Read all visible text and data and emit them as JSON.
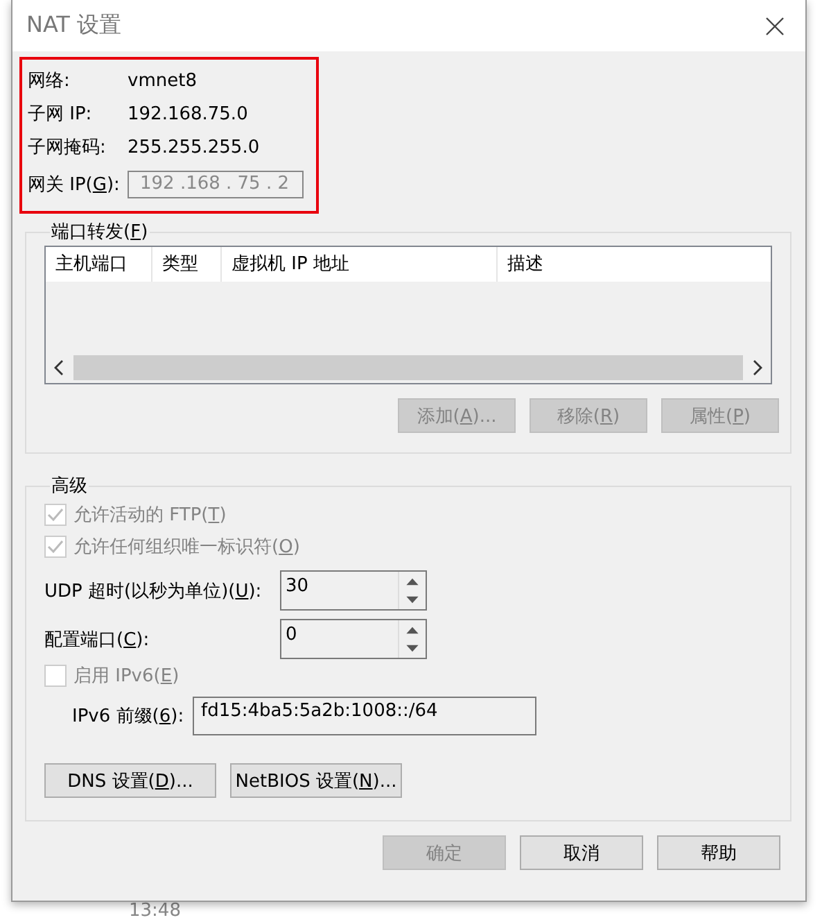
{
  "window": {
    "title": "NAT 设置"
  },
  "background": {
    "time": "13:48"
  },
  "network_info": {
    "highlighted": true,
    "rows": [
      {
        "kind": "text",
        "label": {
          "text": "网络:"
        },
        "value": "vmnet8"
      },
      {
        "kind": "text",
        "label": {
          "text": "子网 IP:"
        },
        "value": "192.168.75.0"
      },
      {
        "kind": "text",
        "label": {
          "text": "子网掩码:"
        },
        "value": "255.255.255.0"
      },
      {
        "kind": "field",
        "label": {
          "text": "网关 IP(",
          "key": "G",
          "after": "):"
        },
        "value": "192 .168 . 75 . 2",
        "disabled": true
      }
    ]
  },
  "port_forwarding": {
    "legend": {
      "text": "端口转发(",
      "key": "F",
      "after": ")"
    },
    "table": {
      "columns": [
        "主机端口",
        "类型",
        "虚拟机 IP 地址",
        "描述"
      ]
    },
    "buttons": [
      {
        "label": {
          "text": "添加(",
          "key": "A",
          "after": ")..."
        },
        "disabled": true
      },
      {
        "label": {
          "text": "移除(",
          "key": "R",
          "after": ")"
        },
        "disabled": true
      },
      {
        "label": {
          "text": "属性(",
          "key": "P",
          "after": ")"
        },
        "disabled": true
      }
    ]
  },
  "advanced": {
    "legend": {
      "text": "高级"
    },
    "options": [
      {
        "kind": "checkbox",
        "label": {
          "text": "允许活动的 FTP(",
          "key": "T",
          "after": ")"
        },
        "checked": true,
        "disabled": true
      },
      {
        "kind": "checkbox",
        "label": {
          "text": "允许任何组织唯一标识符(",
          "key": "O",
          "after": ")"
        },
        "checked": true,
        "disabled": true
      },
      {
        "kind": "spin",
        "label": {
          "text": "UDP 超时(以秒为单位)(",
          "key": "U",
          "after": "):"
        },
        "value": "30"
      },
      {
        "kind": "spin",
        "label": {
          "text": "配置端口(",
          "key": "C",
          "after": "):"
        },
        "value": "0"
      },
      {
        "kind": "checkbox",
        "label": {
          "text": "启用 IPv6(",
          "key": "E",
          "after": ")"
        },
        "checked": false,
        "disabled": true
      },
      {
        "kind": "field",
        "label": {
          "text": "IPv6 前缀(",
          "key": "6",
          "after": "):"
        },
        "value": "fd15:4ba5:5a2b:1008::/64"
      }
    ],
    "buttons": [
      {
        "label": {
          "text": "DNS 设置(",
          "key": "D",
          "after": ")..."
        },
        "disabled": false
      },
      {
        "label": {
          "text": "NetBIOS 设置(",
          "key": "N",
          "after": ")..."
        },
        "disabled": false
      }
    ]
  },
  "footer_buttons": [
    {
      "label": {
        "text": "确定"
      },
      "disabled": true
    },
    {
      "label": {
        "text": "取消"
      },
      "disabled": false
    },
    {
      "label": {
        "text": "帮助"
      },
      "disabled": false
    }
  ]
}
